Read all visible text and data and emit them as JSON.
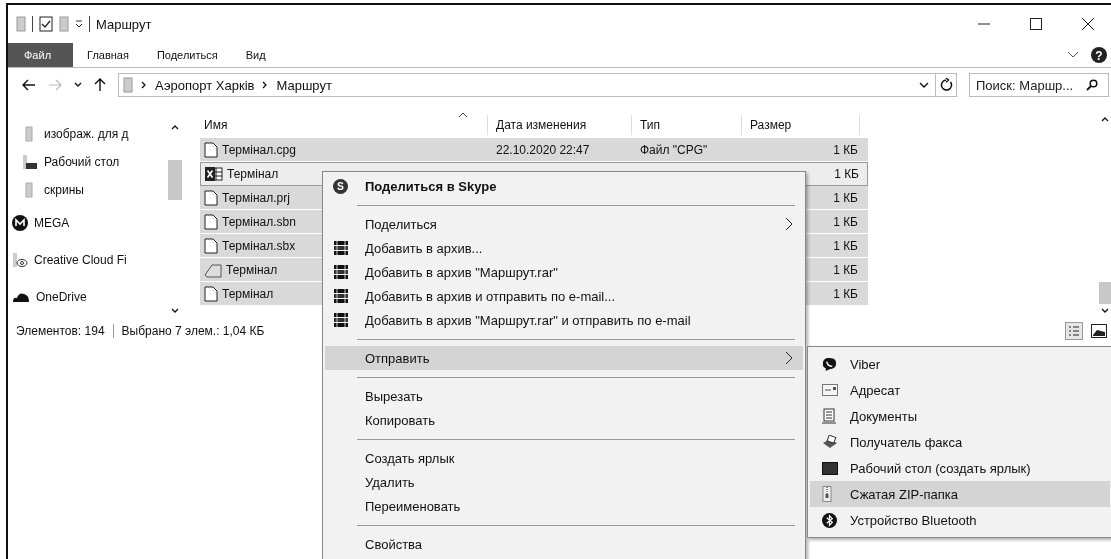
{
  "title_bar": {
    "title": "Маршрут"
  },
  "help_button": {
    "glyph": "?"
  },
  "ribbon_tabs": [
    {
      "label": "Файл",
      "kind": "file",
      "selected": false
    },
    {
      "label": "Главная",
      "kind": "tab",
      "selected": false
    },
    {
      "label": "Поделиться",
      "kind": "tab",
      "selected": false
    },
    {
      "label": "Вид",
      "kind": "tab",
      "selected": false
    }
  ],
  "address_bar": {
    "path": [
      "Аэропорт Харків",
      "Маршрут"
    ]
  },
  "search": {
    "placeholder": "Поиск: Маршр..."
  },
  "sidebar": {
    "items": [
      {
        "label": "изображ. для д",
        "kind": "folder"
      },
      {
        "label": "Рабочий стол",
        "kind": "desktop"
      },
      {
        "label": "скрины",
        "kind": "folder"
      },
      {
        "label": "MEGA",
        "kind": "mega"
      },
      {
        "label": "Creative Cloud Fi",
        "kind": "cloud-folder"
      },
      {
        "label": "OneDrive",
        "kind": "onedrive"
      }
    ]
  },
  "file_list": {
    "columns": [
      "Имя",
      "Дата изменения",
      "Тип",
      "Размер"
    ],
    "rows": [
      {
        "name": "Термінал.cpg",
        "date": "22.10.2020 22:47",
        "type": "Файл \"CPG\"",
        "size": "1 КБ",
        "kind": "blank",
        "selected": true,
        "focused": false
      },
      {
        "name": "Термінал",
        "size": "1 КБ",
        "kind": "spreadsheet",
        "selected": true,
        "focused": true
      },
      {
        "name": "Термінал.prj",
        "size": "1 КБ",
        "kind": "blank",
        "selected": true,
        "focused": false
      },
      {
        "name": "Термінал.sbn",
        "size": "1 КБ",
        "kind": "blank",
        "selected": true,
        "focused": false
      },
      {
        "name": "Термінал.sbx",
        "size": "1 КБ",
        "kind": "blank",
        "selected": true,
        "focused": false
      },
      {
        "name": "Термінал",
        "size": "1 КБ",
        "kind": "shape",
        "selected": true,
        "focused": false
      },
      {
        "name": "Термінал",
        "size": "1 КБ",
        "kind": "blank",
        "selected": true,
        "focused": false
      }
    ]
  },
  "status_bar": {
    "items_count": "Элементов: 194",
    "selection": "Выбрано 7 элем.: 1,04 КБ"
  },
  "context_menu": {
    "items": [
      {
        "kind": "skype",
        "glyph": "S",
        "label": "Поделиться в Skype",
        "bold": true,
        "submenu": false,
        "selected": false
      },
      {
        "kind": "separator"
      },
      {
        "kind": "plain",
        "label": "Поделиться",
        "bold": false,
        "submenu": true,
        "selected": false
      },
      {
        "kind": "archive",
        "label": "Добавить в архив...",
        "bold": false,
        "submenu": false,
        "selected": false
      },
      {
        "kind": "archive",
        "label": "Добавить в архив \"Маршрут.rar\"",
        "bold": false,
        "submenu": false,
        "selected": false
      },
      {
        "kind": "archive",
        "label": "Добавить в архив и отправить по e-mail...",
        "bold": false,
        "submenu": false,
        "selected": false
      },
      {
        "kind": "archive",
        "label": "Добавить в архив \"Маршрут.rar\" и отправить по e-mail",
        "bold": false,
        "submenu": false,
        "selected": false
      },
      {
        "kind": "separator"
      },
      {
        "kind": "plain",
        "label": "Отправить",
        "bold": false,
        "submenu": true,
        "selected": true
      },
      {
        "kind": "separator"
      },
      {
        "kind": "plain",
        "label": "Вырезать",
        "bold": false,
        "submenu": false,
        "selected": false
      },
      {
        "kind": "plain",
        "label": "Копировать",
        "bold": false,
        "submenu": false,
        "selected": false
      },
      {
        "kind": "separator"
      },
      {
        "kind": "plain",
        "label": "Создать ярлык",
        "bold": false,
        "submenu": false,
        "selected": false
      },
      {
        "kind": "plain",
        "label": "Удалить",
        "bold": false,
        "submenu": false,
        "selected": false
      },
      {
        "kind": "plain",
        "label": "Переименовать",
        "bold": false,
        "submenu": false,
        "selected": false
      },
      {
        "kind": "separator"
      },
      {
        "kind": "plain",
        "label": "Свойства",
        "bold": false,
        "submenu": false,
        "selected": false
      }
    ]
  },
  "send_to_menu": {
    "items": [
      {
        "kind": "viber",
        "label": "Viber",
        "selected": false
      },
      {
        "kind": "mail",
        "label": "Адресат",
        "selected": false
      },
      {
        "kind": "documents",
        "label": "Документы",
        "selected": false
      },
      {
        "kind": "fax",
        "label": "Получатель факса",
        "selected": false
      },
      {
        "kind": "desktop",
        "label": "Рабочий стол (создать ярлык)",
        "selected": false
      },
      {
        "kind": "zip",
        "label": "Сжатая ZIP-папка",
        "selected": true
      },
      {
        "kind": "bluetooth",
        "label": "Устройство Bluetooth",
        "selected": false
      }
    ]
  }
}
